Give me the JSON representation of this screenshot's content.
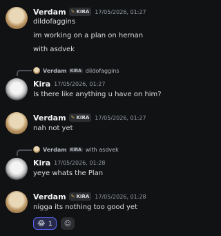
{
  "messages": [
    {
      "author": "Verdam",
      "tag": "KIRA",
      "time": "17/05/2026, 01:27",
      "lines": [
        "dildofaggins",
        "im working on a plan on hernan",
        "with asdvek"
      ]
    },
    {
      "reply": {
        "author": "Verdam",
        "tag": "KIRA",
        "text": "dildofaggins"
      },
      "author": "Kira",
      "time": "17/05/2026, 01:27",
      "lines": [
        "Is there like anything u have on him?"
      ]
    },
    {
      "author": "Verdam",
      "tag": "KIRA",
      "time": "17/05/2026, 01:27",
      "lines": [
        "nah not yet"
      ]
    },
    {
      "reply": {
        "author": "Verdam",
        "tag": "KIRA",
        "text": "with asdvek"
      },
      "author": "Kira",
      "time": "17/05/2026, 01:28",
      "lines": [
        "yeye whats the Plan"
      ]
    },
    {
      "author": "Verdam",
      "tag": "KIRA",
      "time": "17/05/2026, 01:28",
      "lines": [
        "nigga its nothing too good yet"
      ],
      "reaction": {
        "emoji": "😂",
        "count": "1"
      },
      "add_reaction_icon": "add-reaction-icon"
    }
  ],
  "colors": {
    "background": "#111214",
    "accent": "#5865f2"
  }
}
